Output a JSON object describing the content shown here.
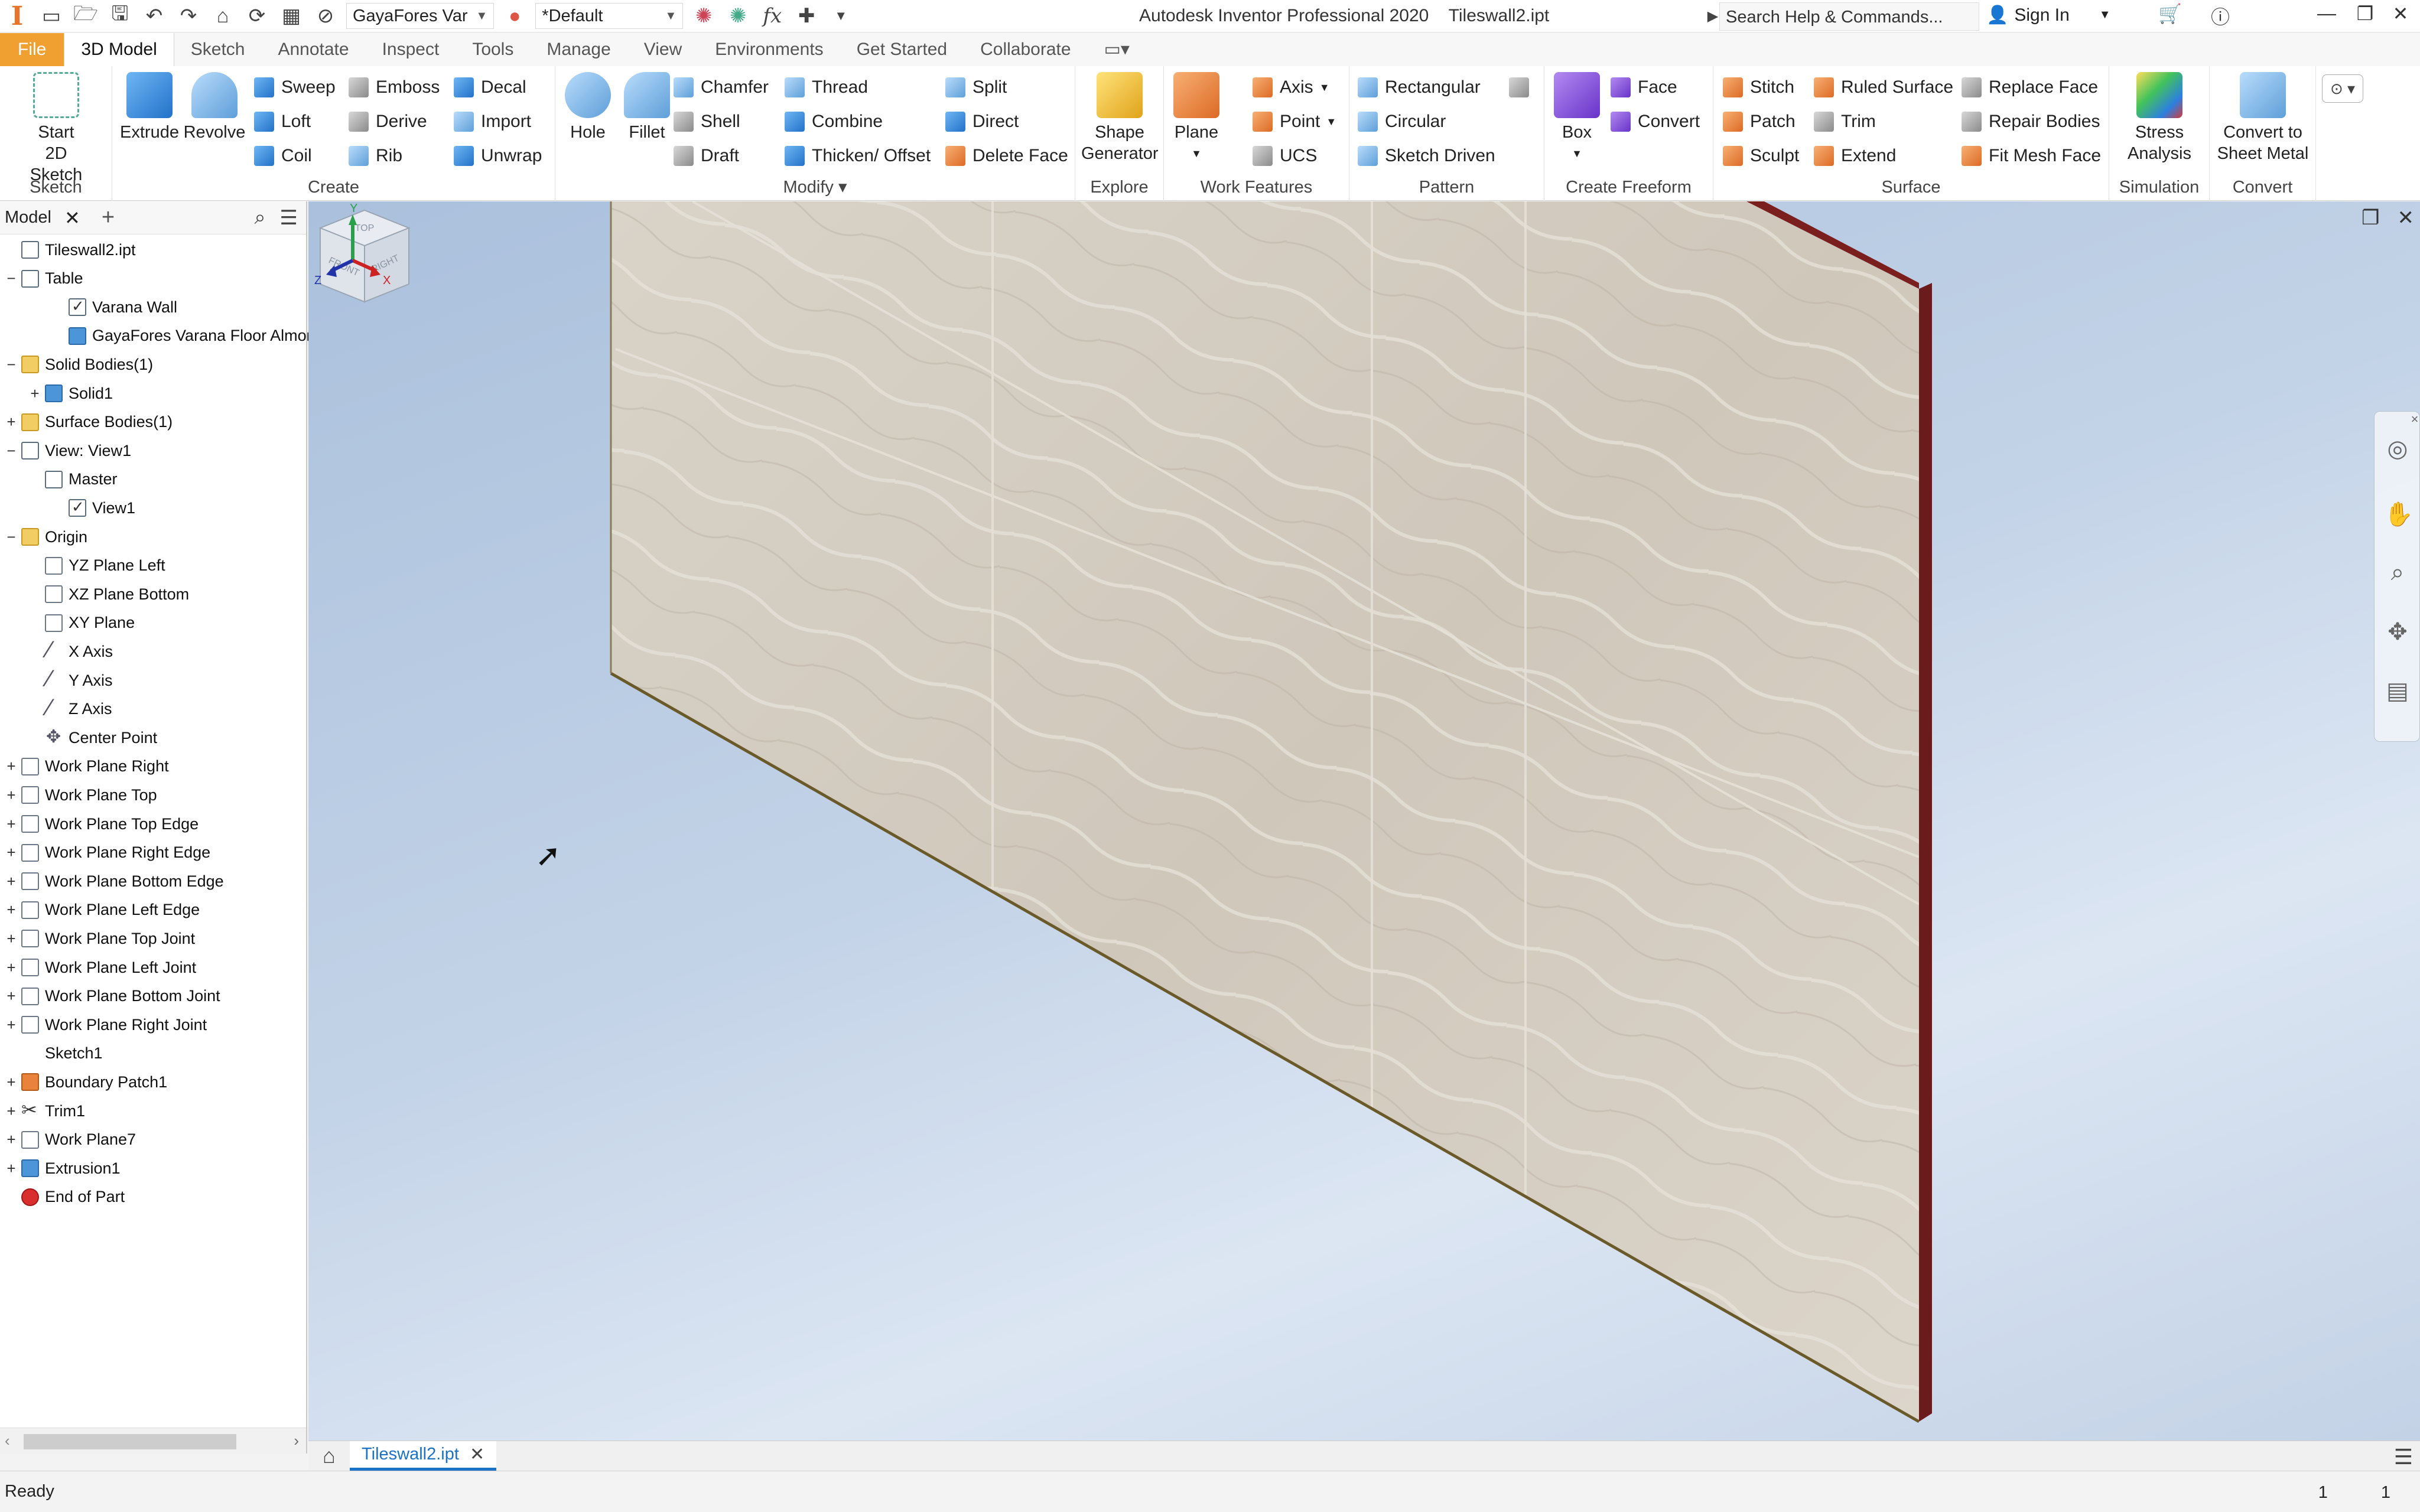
{
  "titlebar": {
    "material": "GayaFores Var",
    "appearance": "*Default",
    "app_title": "Autodesk Inventor Professional 2020",
    "doc_title": "Tileswall2.ipt",
    "search_placeholder": "Search Help & Commands...",
    "sign_in": "Sign In",
    "fx": "fx"
  },
  "ribbon_tabs": [
    "File",
    "3D Model",
    "Sketch",
    "Annotate",
    "Inspect",
    "Tools",
    "Manage",
    "View",
    "Environments",
    "Get Started",
    "Collaborate"
  ],
  "active_tab": "3D Model",
  "ribbon": {
    "sketch": {
      "title": "Sketch",
      "start": "Start",
      "start2": "2D Sketch"
    },
    "create": {
      "title": "Create",
      "extrude": "Extrude",
      "revolve": "Revolve",
      "sweep": "Sweep",
      "loft": "Loft",
      "coil": "Coil",
      "emboss": "Emboss",
      "derive": "Derive",
      "rib": "Rib",
      "decal": "Decal",
      "import": "Import",
      "unwrap": "Unwrap"
    },
    "modify": {
      "title": "Modify",
      "hole": "Hole",
      "fillet": "Fillet",
      "chamfer": "Chamfer",
      "shell": "Shell",
      "draft": "Draft",
      "thread": "Thread",
      "combine": "Combine",
      "thicken": "Thicken/ Offset",
      "split": "Split",
      "direct": "Direct",
      "delete_face": "Delete Face"
    },
    "explore": {
      "title": "Explore",
      "shape": "Shape",
      "generator": "Generator"
    },
    "work_features": {
      "title": "Work Features",
      "plane": "Plane",
      "axis": "Axis",
      "point": "Point",
      "ucs": "UCS"
    },
    "pattern": {
      "title": "Pattern",
      "rectangular": "Rectangular",
      "circular": "Circular",
      "sketch_driven": "Sketch Driven"
    },
    "freeform": {
      "title": "Create Freeform",
      "box": "Box",
      "face": "Face",
      "convert": "Convert"
    },
    "surface": {
      "title": "Surface",
      "stitch": "Stitch",
      "patch": "Patch",
      "sculpt": "Sculpt",
      "ruled": "Ruled Surface",
      "trim": "Trim",
      "extend": "Extend",
      "replace": "Replace Face",
      "repair": "Repair Bodies",
      "fit_mesh": "Fit Mesh Face"
    },
    "simulation": {
      "title": "Simulation",
      "stress": "Stress",
      "analysis": "Analysis"
    },
    "convert": {
      "title": "Convert",
      "to": "Convert to",
      "sheet": "Sheet Metal"
    }
  },
  "browser": {
    "tab": "Model",
    "tree": [
      {
        "label": "Tileswall2.ipt",
        "level": 0,
        "exp": "",
        "icon": "part"
      },
      {
        "label": "Table",
        "level": 0,
        "exp": "−",
        "icon": "table"
      },
      {
        "label": "Varana Wall",
        "level": 2,
        "exp": "",
        "icon": "check"
      },
      {
        "label": "GayaFores Varana Floor Almond",
        "level": 2,
        "exp": "",
        "icon": "blue"
      },
      {
        "label": "Solid Bodies(1)",
        "level": 0,
        "exp": "−",
        "icon": "folder"
      },
      {
        "label": "Solid1",
        "level": 1,
        "exp": "+",
        "icon": "blue"
      },
      {
        "label": "Surface Bodies(1)",
        "level": 0,
        "exp": "+",
        "icon": "folder"
      },
      {
        "label": "View: View1",
        "level": 0,
        "exp": "−",
        "icon": "view"
      },
      {
        "label": "Master",
        "level": 1,
        "exp": "",
        "icon": "lock"
      },
      {
        "label": "View1",
        "level": 2,
        "exp": "",
        "icon": "check"
      },
      {
        "label": "Origin",
        "level": 0,
        "exp": "−",
        "icon": "folder"
      },
      {
        "label": "YZ Plane Left",
        "level": 1,
        "exp": "",
        "icon": "plane"
      },
      {
        "label": "XZ Plane Bottom",
        "level": 1,
        "exp": "",
        "icon": "plane"
      },
      {
        "label": "XY Plane",
        "level": 1,
        "exp": "",
        "icon": "plane"
      },
      {
        "label": "X Axis",
        "level": 1,
        "exp": "",
        "icon": "axis"
      },
      {
        "label": "Y Axis",
        "level": 1,
        "exp": "",
        "icon": "axis"
      },
      {
        "label": "Z Axis",
        "level": 1,
        "exp": "",
        "icon": "axis"
      },
      {
        "label": "Center Point",
        "level": 1,
        "exp": "",
        "icon": "point"
      },
      {
        "label": "Work Plane Right",
        "level": 0,
        "exp": "+",
        "icon": "plane"
      },
      {
        "label": "Work Plane Top",
        "level": 0,
        "exp": "+",
        "icon": "plane"
      },
      {
        "label": "Work Plane Top Edge",
        "level": 0,
        "exp": "+",
        "icon": "plane"
      },
      {
        "label": "Work Plane Right Edge",
        "level": 0,
        "exp": "+",
        "icon": "plane"
      },
      {
        "label": "Work Plane Bottom Edge",
        "level": 0,
        "exp": "+",
        "icon": "plane"
      },
      {
        "label": "Work Plane Left Edge",
        "level": 0,
        "exp": "+",
        "icon": "plane"
      },
      {
        "label": "Work Plane Top Joint",
        "level": 0,
        "exp": "+",
        "icon": "plane"
      },
      {
        "label": "Work Plane Left Joint",
        "level": 0,
        "exp": "+",
        "icon": "plane"
      },
      {
        "label": "Work Plane Bottom Joint",
        "level": 0,
        "exp": "+",
        "icon": "plane"
      },
      {
        "label": "Work Plane Right Joint",
        "level": 0,
        "exp": "+",
        "icon": "plane"
      },
      {
        "label": "Sketch1",
        "level": 0,
        "exp": "",
        "icon": "sketch"
      },
      {
        "label": "Boundary Patch1",
        "level": 0,
        "exp": "+",
        "icon": "orange"
      },
      {
        "label": "Trim1",
        "level": 0,
        "exp": "+",
        "icon": "trim"
      },
      {
        "label": "Work Plane7",
        "level": 0,
        "exp": "+",
        "icon": "plane"
      },
      {
        "label": "Extrusion1",
        "level": 0,
        "exp": "+",
        "icon": "blue"
      },
      {
        "label": "End of Part",
        "level": 0,
        "exp": "",
        "icon": "err"
      }
    ]
  },
  "viewcube": {
    "top": "TOP",
    "front": "FRONT",
    "right": "RIGHT"
  },
  "triad": {
    "x": "X",
    "y": "Y",
    "z": "Z"
  },
  "document_tab": "Tileswall2.ipt",
  "status": {
    "text": "Ready",
    "num1": "1",
    "num2": "1"
  },
  "colors": {
    "accent": "#1a73c7",
    "file_tab": "#f0a030",
    "wall_face": "#d9d2c5",
    "wall_edge": "#7a1e1e"
  },
  "icons": [
    "inventor-logo-icon",
    "new-icon",
    "open-icon",
    "save-icon",
    "undo-icon",
    "redo-icon",
    "home-icon",
    "search-icon",
    "cart-icon",
    "help-icon",
    "close-icon",
    "pan-icon",
    "zoom-icon",
    "orbit-icon",
    "steering-wheel-icon"
  ]
}
